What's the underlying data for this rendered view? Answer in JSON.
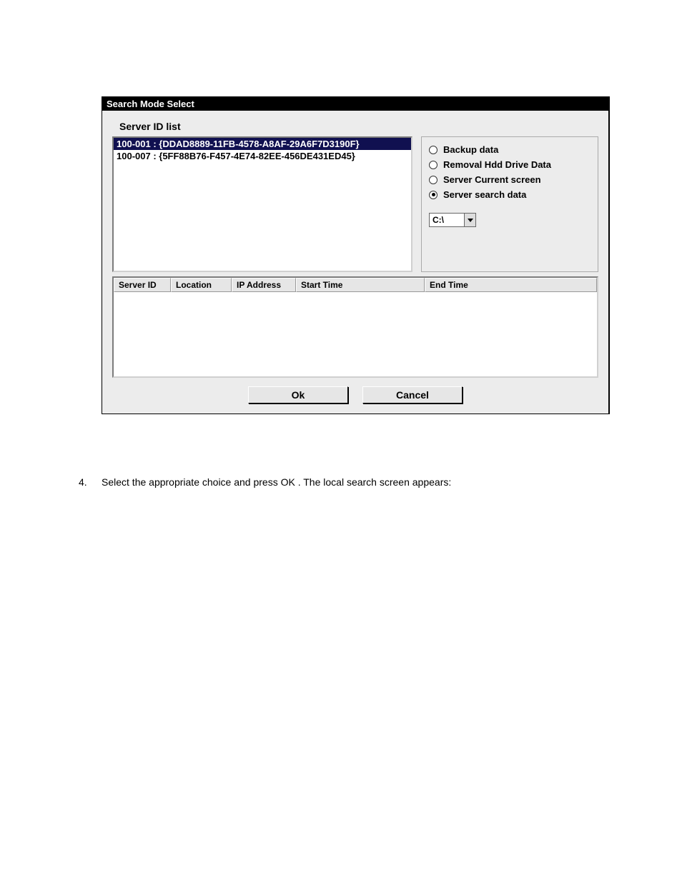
{
  "dialog": {
    "title": "Search Mode Select",
    "server_list_label": "Server ID list",
    "server_items": [
      "100-001 : {DDAD8889-11FB-4578-A8AF-29A6F7D3190F}",
      "100-007 : {5FF88B76-F457-4E74-82EE-456DE431ED45}"
    ],
    "radios": {
      "backup": "Backup data",
      "removal": "Removal Hdd Drive Data",
      "current": "Server Current  screen",
      "search": "Server search data"
    },
    "drive_value": "C:\\",
    "columns": {
      "id": "Server ID",
      "location": "Location",
      "ip": "IP Address",
      "start": "Start Time",
      "end": "End Time"
    },
    "buttons": {
      "ok": "Ok",
      "cancel": "Cancel"
    }
  },
  "instruction": {
    "num": "4.",
    "text": "Select the appropriate choice and press OK . The local search screen appears:"
  }
}
